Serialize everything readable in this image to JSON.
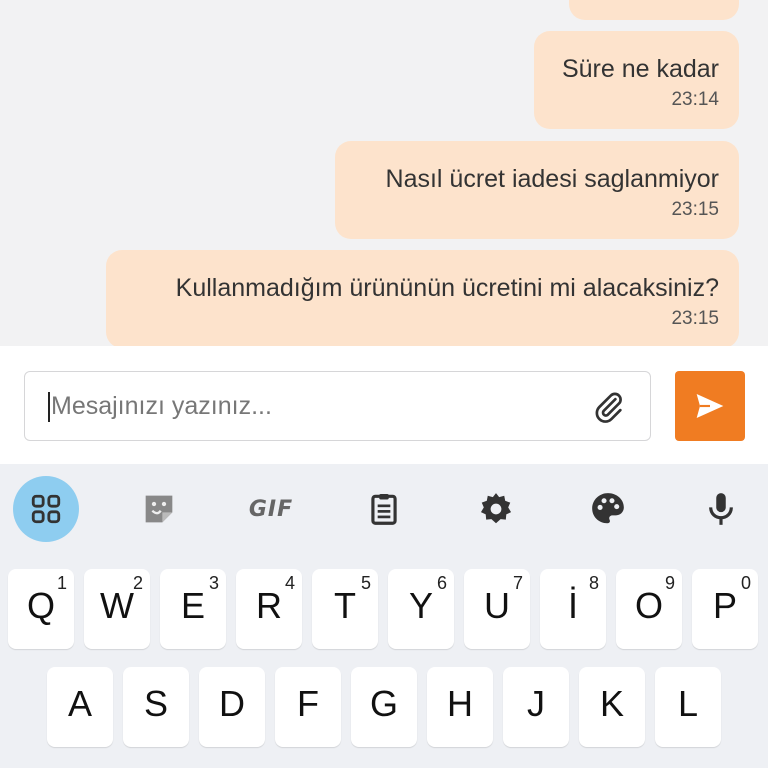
{
  "messages": [
    {
      "text": "",
      "time": ""
    },
    {
      "text": "Süre ne kadar",
      "time": "23:14"
    },
    {
      "text": "Nasıl ücret iadesi saglanmiyor",
      "time": "23:15"
    },
    {
      "text": "Kullanmadığım ürününün ücretini mi alacaksiniz?",
      "time": "23:15"
    }
  ],
  "composer": {
    "placeholder": "Mesajınızı yazınız...",
    "attach_icon": "paperclip-icon",
    "send_icon": "send-icon"
  },
  "toolbar": {
    "items": [
      "apps-grid-icon",
      "sticker-icon",
      "gif-button",
      "clipboard-icon",
      "settings-icon",
      "palette-icon",
      "mic-icon"
    ],
    "gif_label": "GIF"
  },
  "keyboard": {
    "row1": {
      "letters": [
        "Q",
        "W",
        "E",
        "R",
        "T",
        "Y",
        "U",
        "İ",
        "O",
        "P"
      ],
      "hints": [
        "1",
        "2",
        "3",
        "4",
        "5",
        "6",
        "7",
        "8",
        "9",
        "0"
      ]
    },
    "row2": {
      "letters": [
        "A",
        "S",
        "D",
        "F",
        "G",
        "H",
        "J",
        "K",
        "L"
      ]
    }
  },
  "colors": {
    "bubble": "#fde3cc",
    "accent": "#f07c22",
    "active_tool": "#8ecdf0"
  }
}
